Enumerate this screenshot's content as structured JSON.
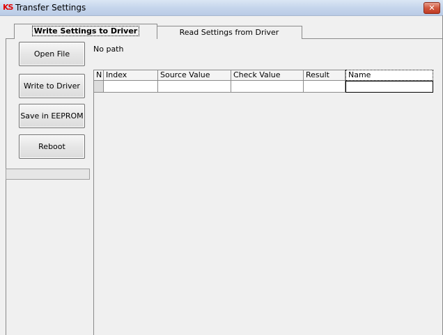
{
  "window": {
    "title": "Transfer Settings",
    "logo_text": "KS",
    "close_symbol": "✕"
  },
  "tabs": [
    {
      "label": "Write Settings to Driver",
      "active": true
    },
    {
      "label": "Read Settings from Driver",
      "active": false
    }
  ],
  "buttons": {
    "open_file": "Open File",
    "write_to_driver": "Write to Driver",
    "save_in_eeprom": "Save in EEPROM",
    "reboot": "Reboot"
  },
  "path_label": "No path",
  "progress": {
    "value": 0
  },
  "table": {
    "columns": [
      "N",
      "Index",
      "Source Value",
      "Check Value",
      "Result",
      "Name"
    ],
    "rows": [
      [
        "",
        "",
        "",
        "",
        "",
        ""
      ]
    ]
  },
  "colors": {
    "logo": "#e00000",
    "progress_fill": "#06b025",
    "close_button": "#c03a22"
  },
  "icons": {
    "app": "ks-logo-icon",
    "close": "close-icon"
  }
}
